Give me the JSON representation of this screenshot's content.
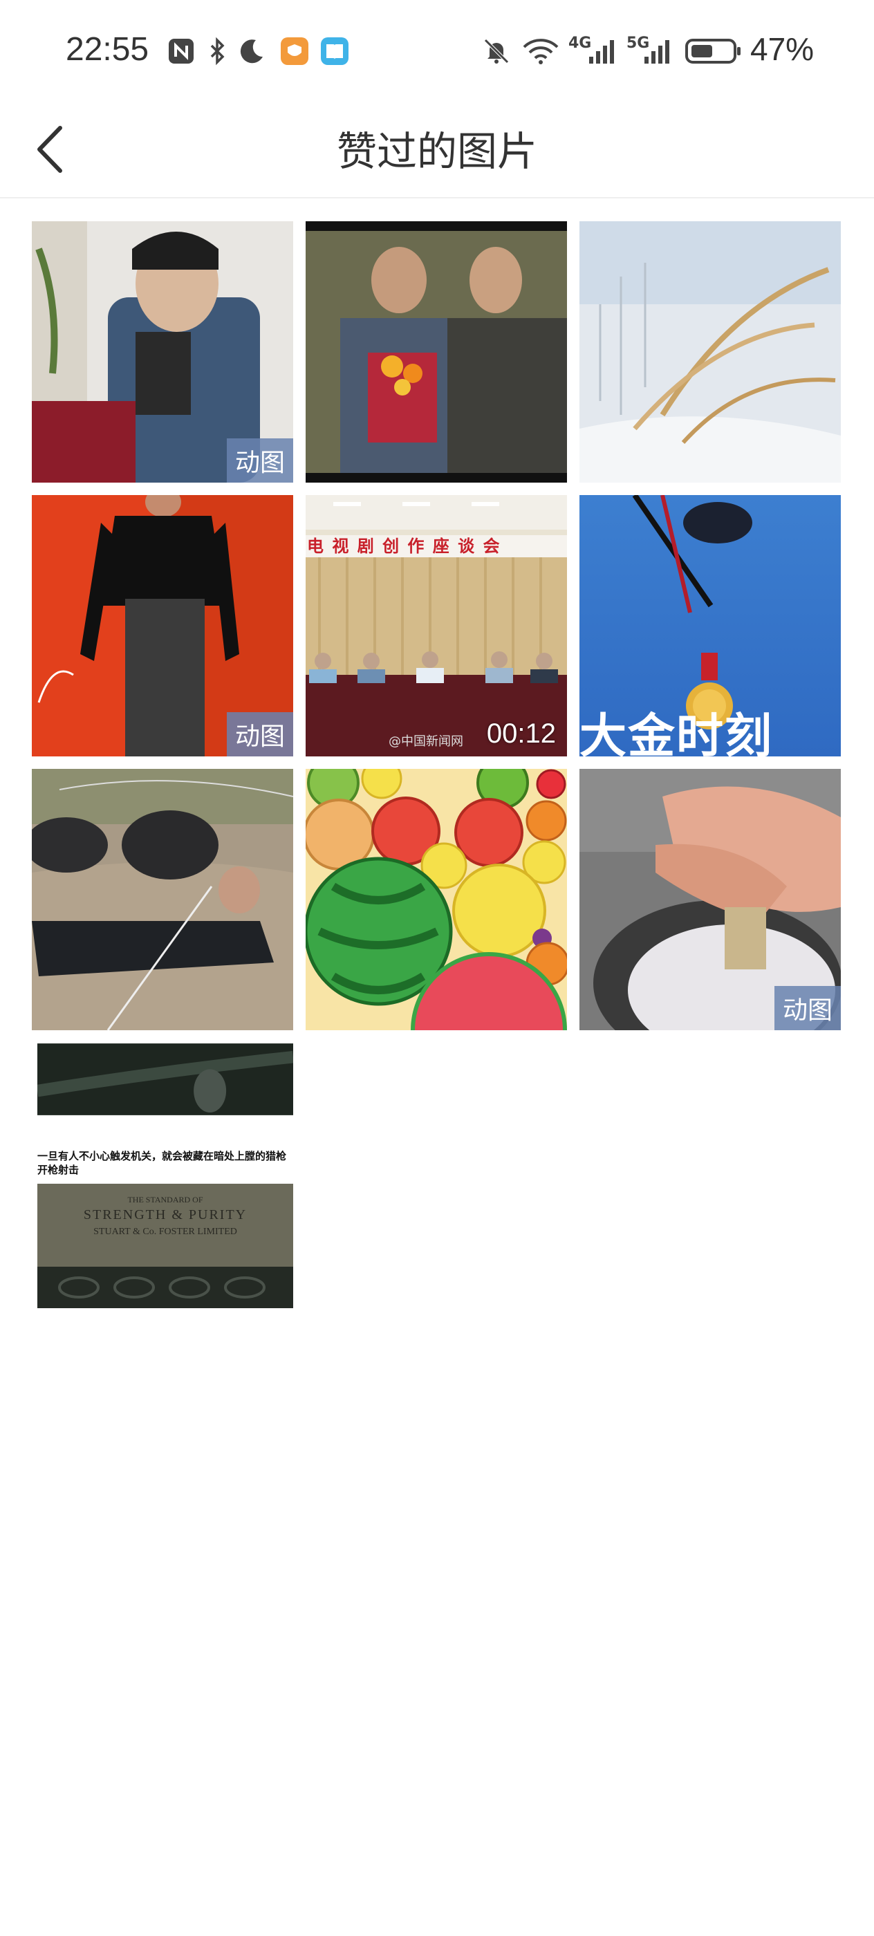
{
  "status_bar": {
    "time": "22:55",
    "network_1": "4G",
    "network_2": "5G",
    "battery_percent": "47%"
  },
  "header": {
    "title": "赞过的图片",
    "back_icon": "chevron-left-icon"
  },
  "grid": {
    "badges": {
      "gif": "动图"
    },
    "tiles": [
      {
        "badge": "动图"
      },
      {},
      {},
      {
        "badge": "动图"
      },
      {
        "banner_text": "电 视 剧 创 作 座 谈 会",
        "duration": "00:12",
        "watermark": "@中国新闻网"
      },
      {
        "overlay_text": "大金时刻"
      },
      {},
      {},
      {
        "badge": "动图"
      }
    ],
    "long_tile": {
      "caption": "一旦有人不小心触发机关，就会被藏在暗处上膛的猎枪开枪射击",
      "crate_text_1": "THE STANDARD OF",
      "crate_text_2": "STRENGTH & PURITY",
      "crate_text_3": "STUART & Co. FOSTER LIMITED"
    }
  },
  "colors": {
    "header_text": "#333333",
    "badge_bg": "#6982af",
    "divider": "#efefef"
  }
}
